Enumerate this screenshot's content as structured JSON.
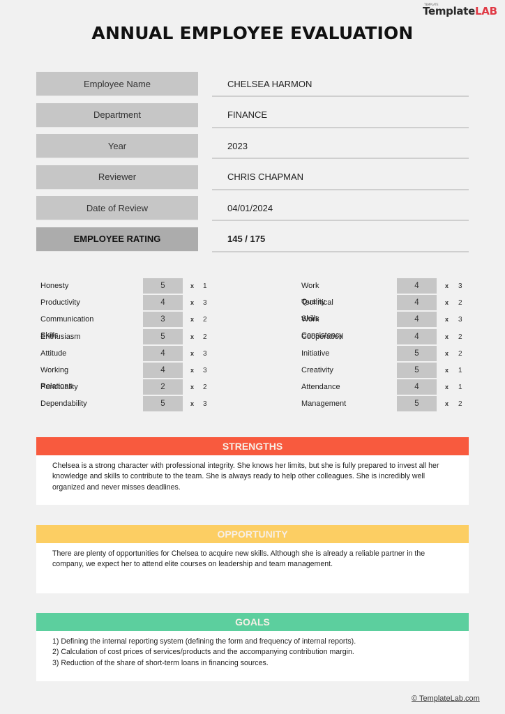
{
  "brand": {
    "logo_small": "TEMPLATE",
    "logo_main": "Template",
    "logo_accent": "LAB"
  },
  "title": "ANNUAL EMPLOYEE EVALUATION",
  "info": [
    {
      "label": "Employee Name",
      "value": "CHELSEA HARMON"
    },
    {
      "label": "Department",
      "value": "FINANCE"
    },
    {
      "label": "Year",
      "value": "2023"
    },
    {
      "label": "Reviewer",
      "value": "CHRIS CHAPMAN"
    },
    {
      "label": "Date of Review",
      "value": "04/01/2024"
    },
    {
      "label": "EMPLOYEE RATING",
      "value": "145 / 175"
    }
  ],
  "ratings": {
    "multiplier_symbol": "x",
    "left": [
      {
        "name": "Honesty",
        "score": "5",
        "weight": "1"
      },
      {
        "name": "Productivity",
        "score": "4",
        "weight": "3"
      },
      {
        "name": "Communication Skills",
        "score": "3",
        "weight": "2"
      },
      {
        "name": "Enthusiasm",
        "score": "5",
        "weight": "2"
      },
      {
        "name": "Attitude",
        "score": "4",
        "weight": "3"
      },
      {
        "name": "Working Relations",
        "score": "4",
        "weight": "3"
      },
      {
        "name": "Punctuality",
        "score": "2",
        "weight": "2"
      },
      {
        "name": "Dependability",
        "score": "5",
        "weight": "3"
      }
    ],
    "right": [
      {
        "name": "Work Quality",
        "score": "4",
        "weight": "3"
      },
      {
        "name": "Technical Skills",
        "score": "4",
        "weight": "2"
      },
      {
        "name": "Work Consistency",
        "score": "4",
        "weight": "3"
      },
      {
        "name": "Cooperation",
        "score": "4",
        "weight": "2"
      },
      {
        "name": "Initiative",
        "score": "5",
        "weight": "2"
      },
      {
        "name": "Creativity",
        "score": "5",
        "weight": "1"
      },
      {
        "name": "Attendance",
        "score": "4",
        "weight": "1"
      },
      {
        "name": "Management",
        "score": "5",
        "weight": "2"
      }
    ]
  },
  "sections": {
    "strengths": {
      "title": "STRENGTHS",
      "color": "#f85a3e",
      "text": "Chelsea is a strong character with professional integrity. She knows her limits, but she is fully prepared to invest all her knowledge and skills to contribute to the team. She is always ready to help other colleagues. She is incredibly well organized and never misses deadlines."
    },
    "opportunity": {
      "title": "OPPORTUNITY",
      "color": "#fcce63",
      "text": "There are plenty of opportunities for Chelsea to acquire new skills. Although she is already a reliable partner in the company, we expect her to attend elite courses on leadership and team management."
    },
    "goals": {
      "title": "GOALS",
      "color": "#5ccf9e",
      "items": [
        "1) Defining the internal reporting system (defining the form and frequency of internal reports).",
        "2) Calculation of cost prices of services/products and the accompanying contribution margin.",
        "3) Reduction of the share of short-term loans in financing sources."
      ]
    }
  },
  "footer": {
    "link_text": "© TemplateLab.com"
  }
}
